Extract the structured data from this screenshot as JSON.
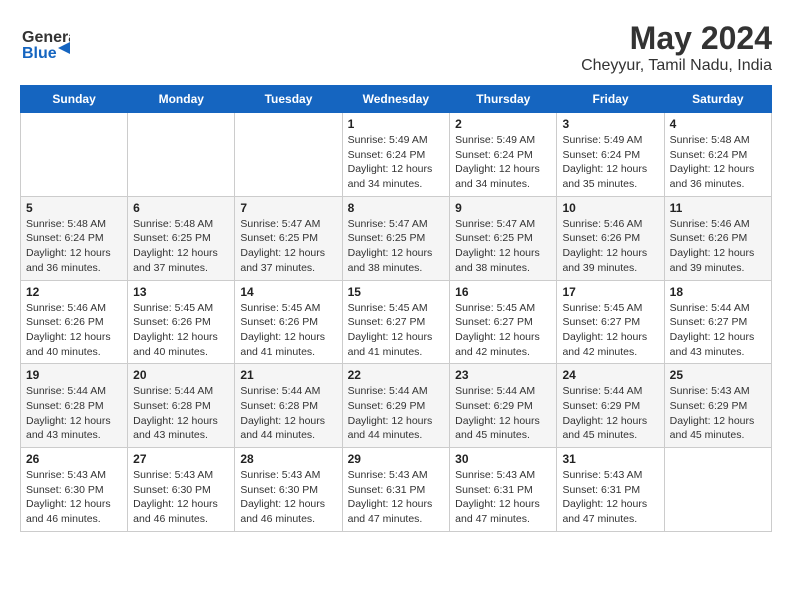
{
  "header": {
    "logo_line1": "General",
    "logo_line2": "Blue",
    "title": "May 2024",
    "subtitle": "Cheyyur, Tamil Nadu, India"
  },
  "weekdays": [
    "Sunday",
    "Monday",
    "Tuesday",
    "Wednesday",
    "Thursday",
    "Friday",
    "Saturday"
  ],
  "weeks": [
    [
      {
        "day": "",
        "info": ""
      },
      {
        "day": "",
        "info": ""
      },
      {
        "day": "",
        "info": ""
      },
      {
        "day": "1",
        "info": "Sunrise: 5:49 AM\nSunset: 6:24 PM\nDaylight: 12 hours\nand 34 minutes."
      },
      {
        "day": "2",
        "info": "Sunrise: 5:49 AM\nSunset: 6:24 PM\nDaylight: 12 hours\nand 34 minutes."
      },
      {
        "day": "3",
        "info": "Sunrise: 5:49 AM\nSunset: 6:24 PM\nDaylight: 12 hours\nand 35 minutes."
      },
      {
        "day": "4",
        "info": "Sunrise: 5:48 AM\nSunset: 6:24 PM\nDaylight: 12 hours\nand 36 minutes."
      }
    ],
    [
      {
        "day": "5",
        "info": "Sunrise: 5:48 AM\nSunset: 6:24 PM\nDaylight: 12 hours\nand 36 minutes."
      },
      {
        "day": "6",
        "info": "Sunrise: 5:48 AM\nSunset: 6:25 PM\nDaylight: 12 hours\nand 37 minutes."
      },
      {
        "day": "7",
        "info": "Sunrise: 5:47 AM\nSunset: 6:25 PM\nDaylight: 12 hours\nand 37 minutes."
      },
      {
        "day": "8",
        "info": "Sunrise: 5:47 AM\nSunset: 6:25 PM\nDaylight: 12 hours\nand 38 minutes."
      },
      {
        "day": "9",
        "info": "Sunrise: 5:47 AM\nSunset: 6:25 PM\nDaylight: 12 hours\nand 38 minutes."
      },
      {
        "day": "10",
        "info": "Sunrise: 5:46 AM\nSunset: 6:26 PM\nDaylight: 12 hours\nand 39 minutes."
      },
      {
        "day": "11",
        "info": "Sunrise: 5:46 AM\nSunset: 6:26 PM\nDaylight: 12 hours\nand 39 minutes."
      }
    ],
    [
      {
        "day": "12",
        "info": "Sunrise: 5:46 AM\nSunset: 6:26 PM\nDaylight: 12 hours\nand 40 minutes."
      },
      {
        "day": "13",
        "info": "Sunrise: 5:45 AM\nSunset: 6:26 PM\nDaylight: 12 hours\nand 40 minutes."
      },
      {
        "day": "14",
        "info": "Sunrise: 5:45 AM\nSunset: 6:26 PM\nDaylight: 12 hours\nand 41 minutes."
      },
      {
        "day": "15",
        "info": "Sunrise: 5:45 AM\nSunset: 6:27 PM\nDaylight: 12 hours\nand 41 minutes."
      },
      {
        "day": "16",
        "info": "Sunrise: 5:45 AM\nSunset: 6:27 PM\nDaylight: 12 hours\nand 42 minutes."
      },
      {
        "day": "17",
        "info": "Sunrise: 5:45 AM\nSunset: 6:27 PM\nDaylight: 12 hours\nand 42 minutes."
      },
      {
        "day": "18",
        "info": "Sunrise: 5:44 AM\nSunset: 6:27 PM\nDaylight: 12 hours\nand 43 minutes."
      }
    ],
    [
      {
        "day": "19",
        "info": "Sunrise: 5:44 AM\nSunset: 6:28 PM\nDaylight: 12 hours\nand 43 minutes."
      },
      {
        "day": "20",
        "info": "Sunrise: 5:44 AM\nSunset: 6:28 PM\nDaylight: 12 hours\nand 43 minutes."
      },
      {
        "day": "21",
        "info": "Sunrise: 5:44 AM\nSunset: 6:28 PM\nDaylight: 12 hours\nand 44 minutes."
      },
      {
        "day": "22",
        "info": "Sunrise: 5:44 AM\nSunset: 6:29 PM\nDaylight: 12 hours\nand 44 minutes."
      },
      {
        "day": "23",
        "info": "Sunrise: 5:44 AM\nSunset: 6:29 PM\nDaylight: 12 hours\nand 45 minutes."
      },
      {
        "day": "24",
        "info": "Sunrise: 5:44 AM\nSunset: 6:29 PM\nDaylight: 12 hours\nand 45 minutes."
      },
      {
        "day": "25",
        "info": "Sunrise: 5:43 AM\nSunset: 6:29 PM\nDaylight: 12 hours\nand 45 minutes."
      }
    ],
    [
      {
        "day": "26",
        "info": "Sunrise: 5:43 AM\nSunset: 6:30 PM\nDaylight: 12 hours\nand 46 minutes."
      },
      {
        "day": "27",
        "info": "Sunrise: 5:43 AM\nSunset: 6:30 PM\nDaylight: 12 hours\nand 46 minutes."
      },
      {
        "day": "28",
        "info": "Sunrise: 5:43 AM\nSunset: 6:30 PM\nDaylight: 12 hours\nand 46 minutes."
      },
      {
        "day": "29",
        "info": "Sunrise: 5:43 AM\nSunset: 6:31 PM\nDaylight: 12 hours\nand 47 minutes."
      },
      {
        "day": "30",
        "info": "Sunrise: 5:43 AM\nSunset: 6:31 PM\nDaylight: 12 hours\nand 47 minutes."
      },
      {
        "day": "31",
        "info": "Sunrise: 5:43 AM\nSunset: 6:31 PM\nDaylight: 12 hours\nand 47 minutes."
      },
      {
        "day": "",
        "info": ""
      }
    ]
  ]
}
